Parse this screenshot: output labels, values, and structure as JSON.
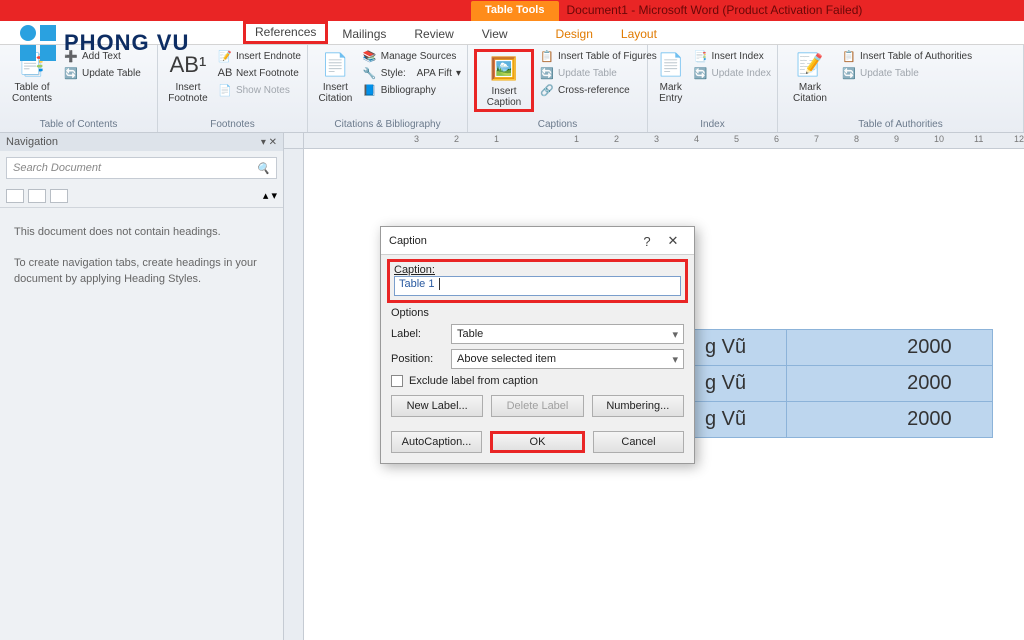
{
  "logo_text": "PHONG VU",
  "titlebar": {
    "contextual": "Table Tools",
    "doc": "Document1 - Microsoft Word (Product Activation Failed)"
  },
  "tabs": {
    "references": "References",
    "mailings": "Mailings",
    "review": "Review",
    "view": "View",
    "design": "Design",
    "layout": "Layout"
  },
  "ribbon": {
    "toc": {
      "big": "Table of\nContents",
      "add_text": "Add Text",
      "update": "Update Table",
      "group": "Table of Contents"
    },
    "fn": {
      "big": "Insert\nFootnote",
      "endnote": "Insert Endnote",
      "next": "Next Footnote",
      "show": "Show Notes",
      "group": "Footnotes"
    },
    "cite": {
      "big": "Insert\nCitation",
      "manage": "Manage Sources",
      "style_lbl": "Style:",
      "style_val": "APA Fift",
      "bib": "Bibliography",
      "group": "Citations & Bibliography"
    },
    "cap": {
      "big": "Insert\nCaption",
      "itof": "Insert Table of Figures",
      "update": "Update Table",
      "cross": "Cross-reference",
      "group": "Captions"
    },
    "idx": {
      "big": "Mark\nEntry",
      "insert": "Insert Index",
      "update": "Update Index",
      "group": "Index"
    },
    "toa": {
      "big": "Mark\nCitation",
      "insert": "Insert Table of Authorities",
      "update": "Update Table",
      "group": "Table of Authorities"
    }
  },
  "nav": {
    "title": "Navigation",
    "search_ph": "Search Document",
    "msg1": "This document does not contain headings.",
    "msg2": "To create navigation tabs, create headings in your document by applying Heading Styles."
  },
  "ruler_ticks": [
    "3",
    "2",
    "1",
    "",
    "1",
    "2",
    "3",
    "4",
    "5",
    "6",
    "7",
    "8",
    "9",
    "10",
    "11",
    "12"
  ],
  "table_rows": [
    {
      "c1": "g Vũ",
      "c2": "2000"
    },
    {
      "c1": "g Vũ",
      "c2": "2000"
    },
    {
      "c1": "g Vũ",
      "c2": "2000"
    }
  ],
  "dialog": {
    "title": "Caption",
    "caption_lbl": "Caption:",
    "caption_val": "Table 1",
    "options": "Options",
    "label_lbl": "Label:",
    "label_val": "Table",
    "pos_lbl": "Position:",
    "pos_val": "Above selected item",
    "exclude": "Exclude label from caption",
    "new_label": "New Label...",
    "del_label": "Delete Label",
    "numbering": "Numbering...",
    "autocap": "AutoCaption...",
    "ok": "OK",
    "cancel": "Cancel",
    "help": "?",
    "close": "✕"
  }
}
